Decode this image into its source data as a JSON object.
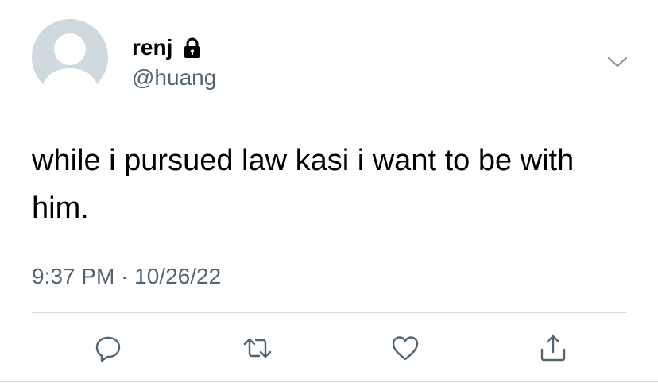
{
  "tweet": {
    "display_name": "renj",
    "handle": "@huang",
    "text": "while i pursued law kasi i want to be with him.",
    "timestamp": "9:37 PM · 10/26/22"
  },
  "icons": {
    "protected": "lock-icon",
    "menu": "chevron-down-icon",
    "reply": "reply-icon",
    "retweet": "retweet-icon",
    "like": "heart-icon",
    "share": "share-icon"
  },
  "colors": {
    "text_primary": "#000000",
    "text_secondary": "#536471",
    "avatar_bg": "#cfd9de",
    "divider": "#cfd9de"
  }
}
